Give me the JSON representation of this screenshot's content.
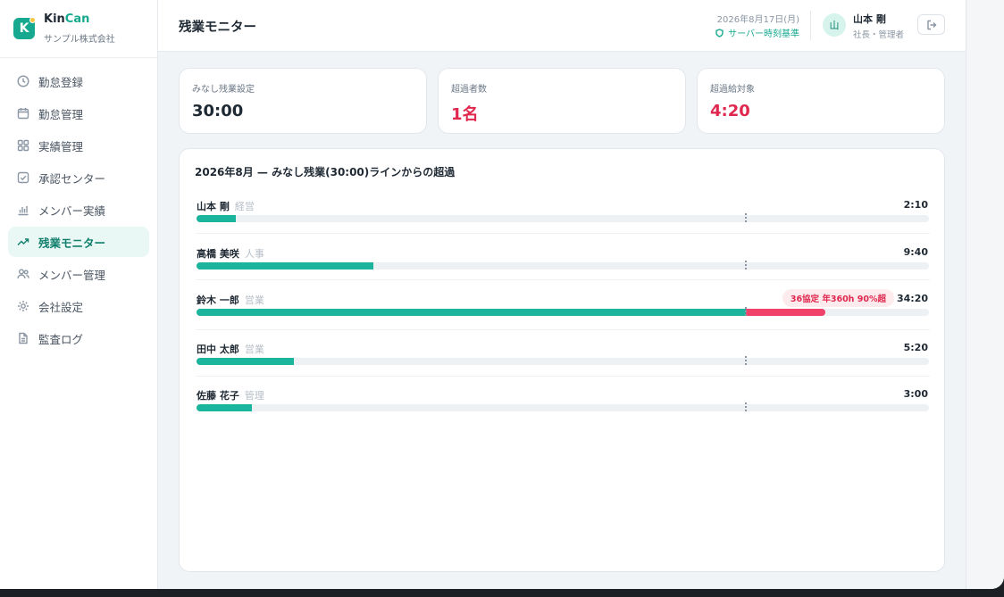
{
  "app": {
    "brand_prefix": "Kin",
    "brand_accent": "Can",
    "company": "サンプル株式会社",
    "logo_letter": "K"
  },
  "sidebar": {
    "items": [
      {
        "label": "勤怠登録",
        "icon": "clock-icon"
      },
      {
        "label": "勤怠管理",
        "icon": "calendar-icon"
      },
      {
        "label": "実績管理",
        "icon": "grid-icon"
      },
      {
        "label": "承認センター",
        "icon": "check-square-icon"
      },
      {
        "label": "メンバー実績",
        "icon": "bar-chart-icon"
      },
      {
        "label": "残業モニター",
        "icon": "trend-up-icon",
        "active": true
      },
      {
        "label": "メンバー管理",
        "icon": "users-icon"
      },
      {
        "label": "会社設定",
        "icon": "gear-icon"
      },
      {
        "label": "監査ログ",
        "icon": "document-icon"
      }
    ]
  },
  "header": {
    "title": "残業モニター",
    "date": "2026年8月17日(月)",
    "server_time": "サーバー時刻基準",
    "user": {
      "initial": "山",
      "name": "山本 剛",
      "role": "社長・管理者"
    }
  },
  "stats": [
    {
      "label": "みなし残業設定",
      "value": "30:00",
      "accent": false
    },
    {
      "label": "超過者数",
      "value": "1名",
      "accent": true
    },
    {
      "label": "超過給対象",
      "value": "4:20",
      "accent": true
    }
  ],
  "panel": {
    "title": "2026年8月 — みなし残業(30:00)ラインからの超過",
    "threshold_hours": 30,
    "scale_max_hours": 40,
    "employees": [
      {
        "name": "山本 剛",
        "dept": "経営",
        "time": "2:10",
        "hours": 2.1667
      },
      {
        "name": "高橋 美咲",
        "dept": "人事",
        "time": "9:40",
        "hours": 9.6667
      },
      {
        "name": "鈴木 一郎",
        "dept": "営業",
        "time": "34:20",
        "hours": 34.3333,
        "badge": "36協定 年360h 90%超"
      },
      {
        "name": "田中 太郎",
        "dept": "営業",
        "time": "5:20",
        "hours": 5.3333
      },
      {
        "name": "佐藤 花子",
        "dept": "管理",
        "time": "3:00",
        "hours": 3.0
      }
    ]
  },
  "colors": {
    "accent": "#17a98f",
    "bar": "#1bb49c",
    "excess": "#f0426a",
    "alert": "#e0284f"
  }
}
